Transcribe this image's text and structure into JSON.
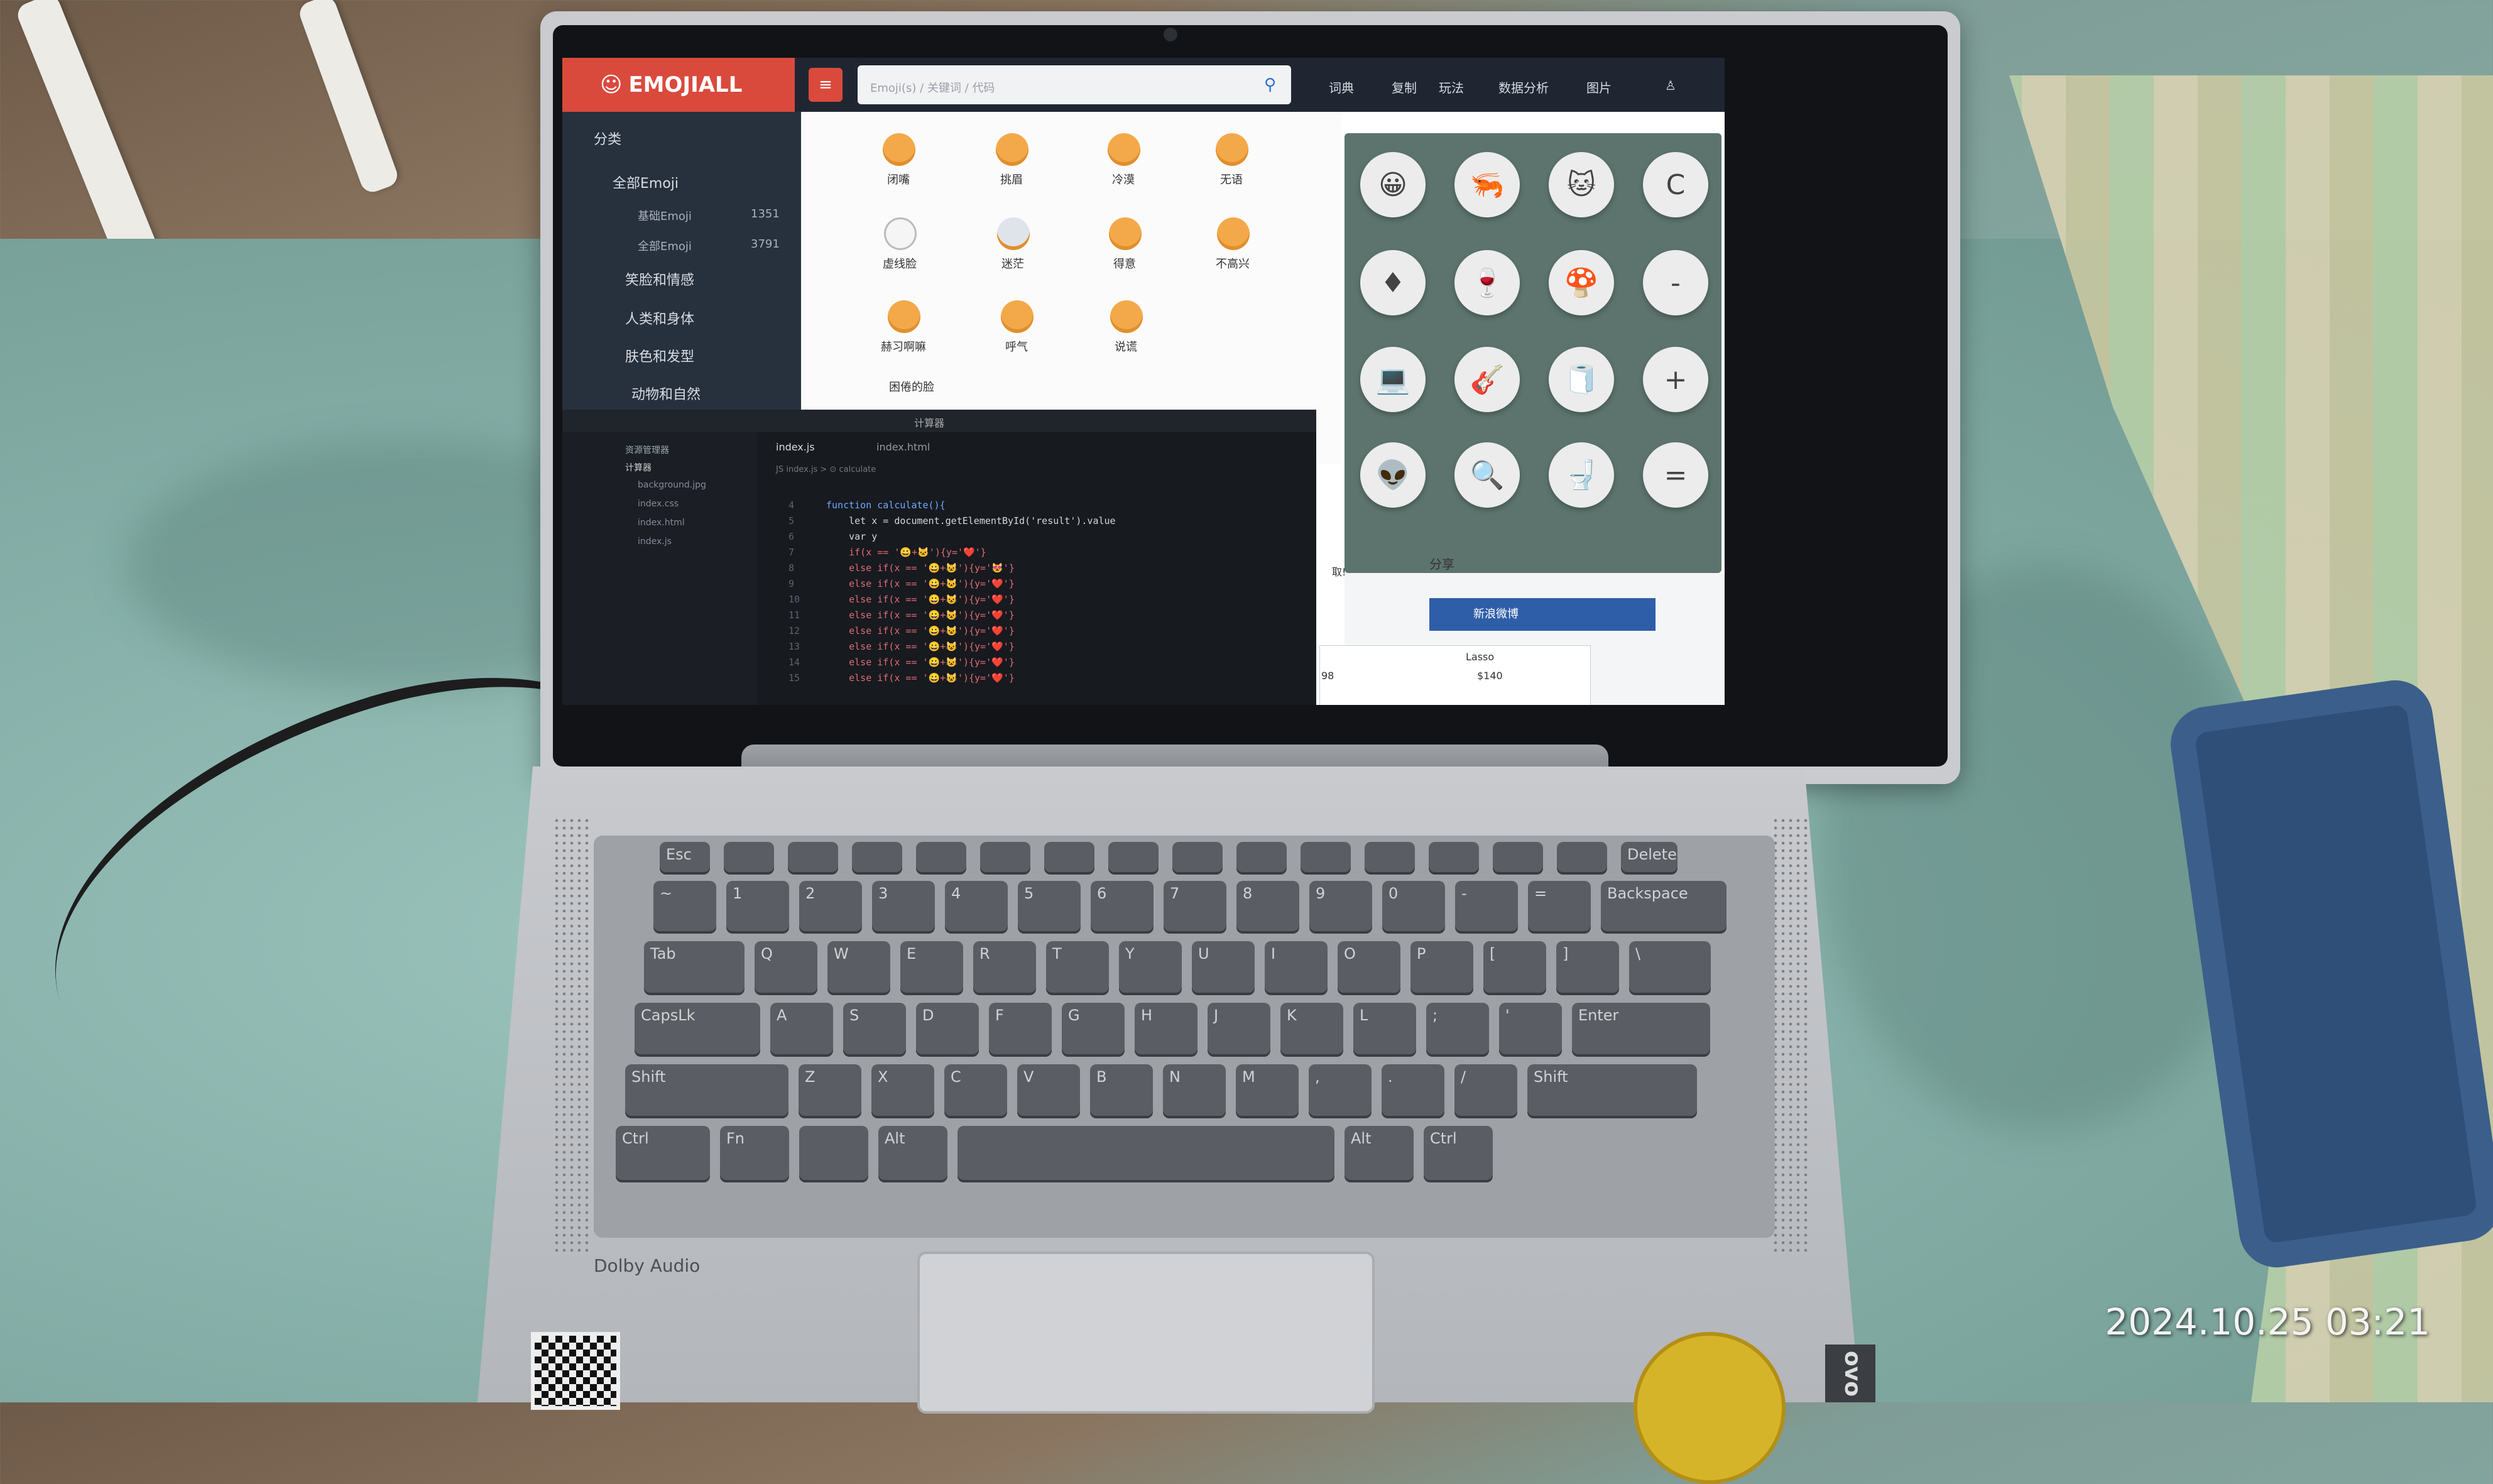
{
  "photo": {
    "timestamp": "2024.10.25   03:21",
    "laptop_brand_fragment": "ovo",
    "dolby_label": "Dolby Audio"
  },
  "website": {
    "logo": "EMOJIALL",
    "search_placeholder": "Emoji(s) / 关键词 / 代码",
    "nav": [
      "词典",
      "复制",
      "玩法",
      "数据分析",
      "图片"
    ],
    "sidebar_title": "分类",
    "sidebar_items": [
      {
        "label": "全部Emoji",
        "count": ""
      },
      {
        "label": "基础Emoji",
        "count": "1351"
      },
      {
        "label": "全部Emoji",
        "count": "3791"
      },
      {
        "label": "笑脸和情感",
        "count": ""
      },
      {
        "label": "人类和身体",
        "count": ""
      },
      {
        "label": "肤色和发型",
        "count": ""
      },
      {
        "label": "动物和自然",
        "count": ""
      }
    ],
    "emoji_labels": [
      "闭嘴",
      "挑眉",
      "冷漠",
      "无语",
      "虚线脸",
      "迷茫",
      "得意",
      "不高兴",
      "赫习啊嘛",
      "呼气",
      "说谎"
    ],
    "section_label": "困倦的脸",
    "share_title": "分享",
    "share_button": "新浪微博",
    "side_label": "取!",
    "ad": {
      "title": "Lasso",
      "price": "$140",
      "left_price": "98"
    }
  },
  "calculator": {
    "title": "计算器",
    "buttons": [
      "C",
      "-",
      "+",
      "="
    ]
  },
  "editor": {
    "tabs": [
      "index.js",
      "index.html"
    ],
    "breadcrumb": "JS index.js > ⊙ calculate",
    "explorer_title": "资源管理器",
    "folder": "计算器",
    "files": [
      "background.jpg",
      "index.css",
      "index.html",
      "index.js"
    ],
    "lines": [
      {
        "n": "4",
        "text": "function calculate(){"
      },
      {
        "n": "5",
        "text": "    let x = document.getElementById('result').value"
      },
      {
        "n": "6",
        "text": "    var y"
      },
      {
        "n": "7",
        "text": "    if(x == '😀+🐱'){y='❤️'}"
      },
      {
        "n": "8",
        "text": "    else if(x == '😀+😺'){y='😻'}"
      },
      {
        "n": "9",
        "text": "    else if(x == '😀+🐱'){y='❤️'}"
      },
      {
        "n": "10",
        "text": "    else if(x == '😀+😺'){y='❤️'}"
      },
      {
        "n": "11",
        "text": "    else if(x == '😀+😺'){y='❤️'}"
      },
      {
        "n": "12",
        "text": "    else if(x == '😀+😺'){y='❤️'}"
      },
      {
        "n": "13",
        "text": "    else if(x == '😀+😺'){y='❤️'}"
      },
      {
        "n": "14",
        "text": "    else if(x == '😀+😺'){y='❤️'}"
      },
      {
        "n": "15",
        "text": "    else if(x == '😀+😺'){y='❤️'}"
      }
    ]
  },
  "keyboard": {
    "row_fn": [
      "Esc",
      "",
      "",
      "",
      "",
      "",
      "",
      "",
      "",
      "",
      "",
      "",
      "",
      "",
      "",
      "Delete"
    ],
    "row_num": [
      "~",
      "1",
      "2",
      "3",
      "4",
      "5",
      "6",
      "7",
      "8",
      "9",
      "0",
      "-",
      "=",
      "Backspace"
    ],
    "row_q": [
      "Tab",
      "Q",
      "W",
      "E",
      "R",
      "T",
      "Y",
      "U",
      "I",
      "O",
      "P",
      "[",
      "]",
      "\\"
    ],
    "row_a": [
      "CapsLk",
      "A",
      "S",
      "D",
      "F",
      "G",
      "H",
      "J",
      "K",
      "L",
      ";",
      "'",
      "Enter"
    ],
    "row_z": [
      "Shift",
      "Z",
      "X",
      "C",
      "V",
      "B",
      "N",
      "M",
      ",",
      ".",
      "/",
      "Shift"
    ],
    "row_bottom": [
      "Ctrl",
      "Fn",
      "",
      "Alt",
      "",
      "Alt",
      "Ctrl"
    ]
  }
}
